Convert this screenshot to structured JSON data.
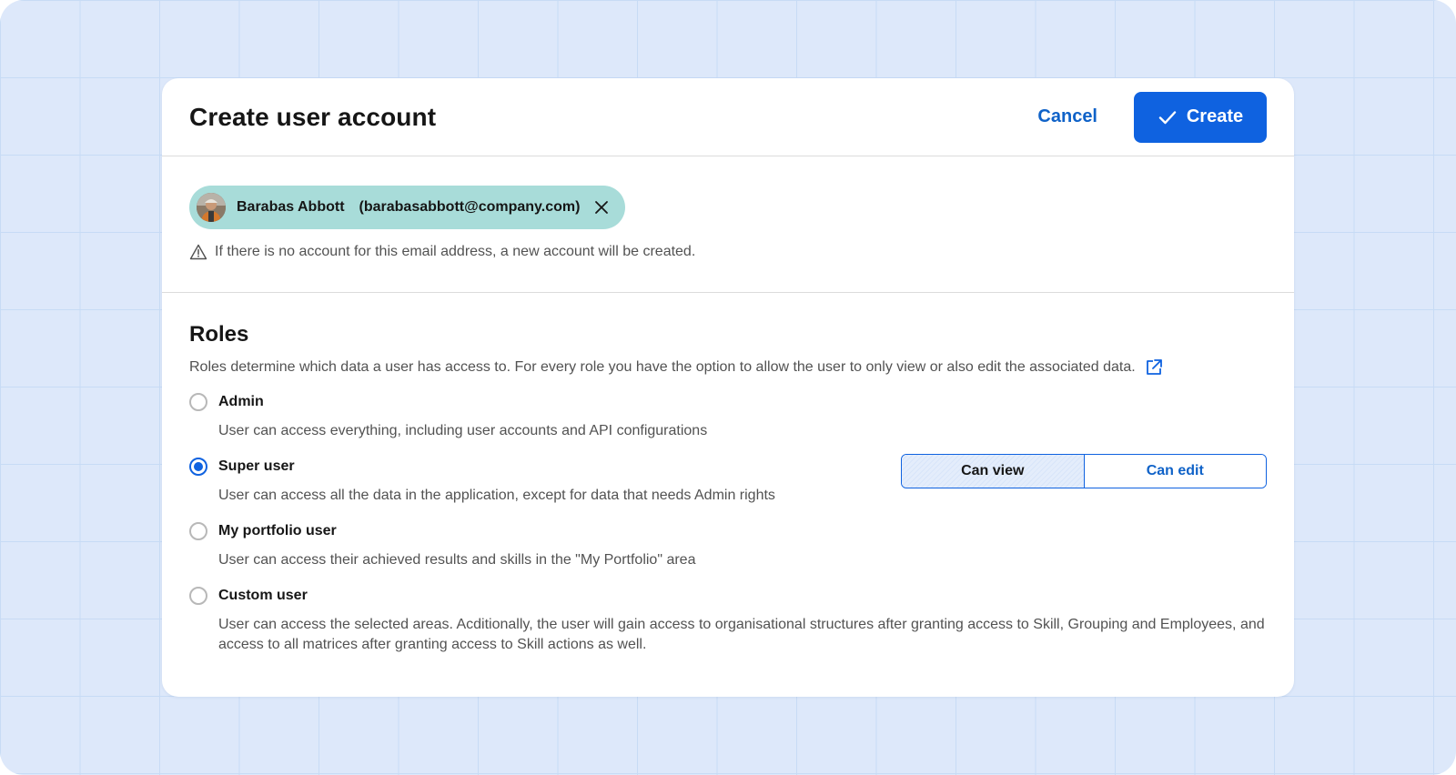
{
  "header": {
    "title": "Create user account",
    "cancel_label": "Cancel",
    "create_label": "Create"
  },
  "user": {
    "name": "Barabas Abbott",
    "email": "(barabasabbott@company.com)",
    "note": "If there is no account for this email address, a new account will be created."
  },
  "roles": {
    "title": "Roles",
    "description": "Roles determine which data a user has access to. For every role you have the option to allow the user to only view or also edit the associated data.",
    "items": [
      {
        "label": "Admin",
        "description": "User can access everything, including user accounts and API configurations",
        "selected": false
      },
      {
        "label": "Super user",
        "description": "User can access all the data in the application, except for data that needs Admin rights",
        "selected": true
      },
      {
        "label": "My portfolio user",
        "description": "User can access their achieved results and skills in the \"My Portfolio\" area",
        "selected": false
      },
      {
        "label": "Custom user",
        "description": "User can access the selected areas. Acditionally, the user will gain access to organisational structures after granting access to Skill, Grouping and Employees, and access to all matrices after granting access to Skill actions as well.",
        "selected": false
      }
    ],
    "permission_toggle": {
      "options": [
        "Can view",
        "Can edit"
      ],
      "selected": "Can view"
    }
  },
  "colors": {
    "accent": "#0f62e0",
    "chip_bg": "#a8dcd9",
    "page_bg": "#dde8fa"
  },
  "icons": [
    "check-icon",
    "avatar",
    "close-icon",
    "warning-icon",
    "external-link-icon"
  ]
}
